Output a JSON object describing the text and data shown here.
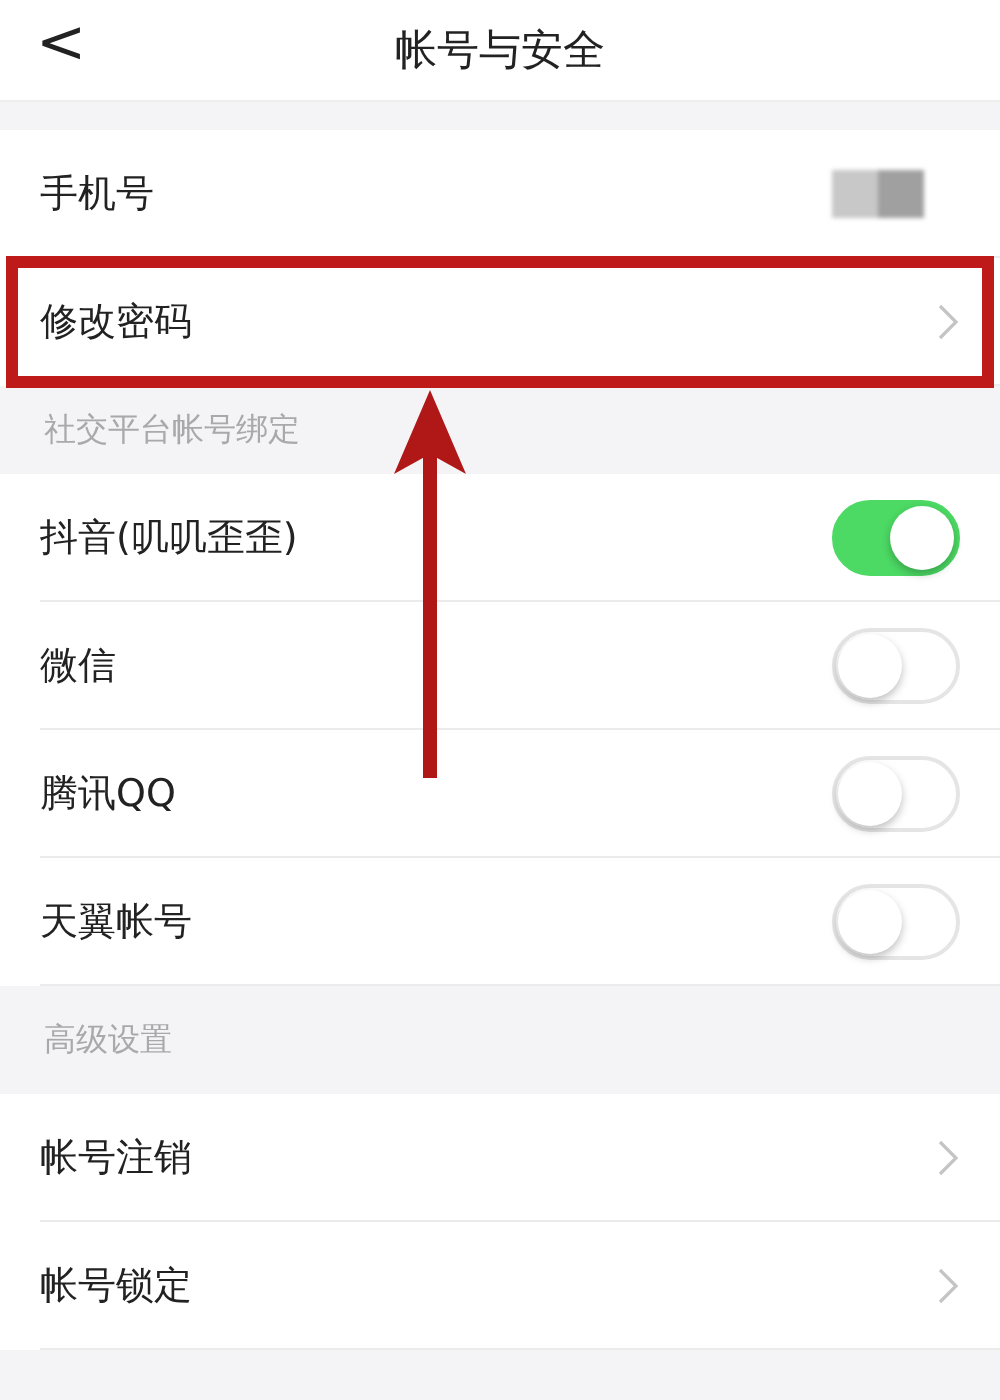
{
  "header": {
    "back_icon": "<",
    "title": "帐号与安全"
  },
  "sections": [
    {
      "rows": [
        {
          "kind": "value",
          "label": "手机号",
          "masked": true
        },
        {
          "kind": "link",
          "label": "修改密码",
          "highlighted": true
        }
      ]
    },
    {
      "title": "社交平台帐号绑定",
      "rows": [
        {
          "kind": "toggle",
          "label": "抖音(叽叽歪歪)",
          "on": true
        },
        {
          "kind": "toggle",
          "label": "微信",
          "on": false
        },
        {
          "kind": "toggle",
          "label": "腾讯QQ",
          "on": false
        },
        {
          "kind": "toggle",
          "label": "天翼帐号",
          "on": false
        }
      ]
    },
    {
      "title": "高级设置",
      "rows": [
        {
          "kind": "link",
          "label": "帐号注销"
        },
        {
          "kind": "link",
          "label": "帐号锁定"
        }
      ]
    }
  ]
}
